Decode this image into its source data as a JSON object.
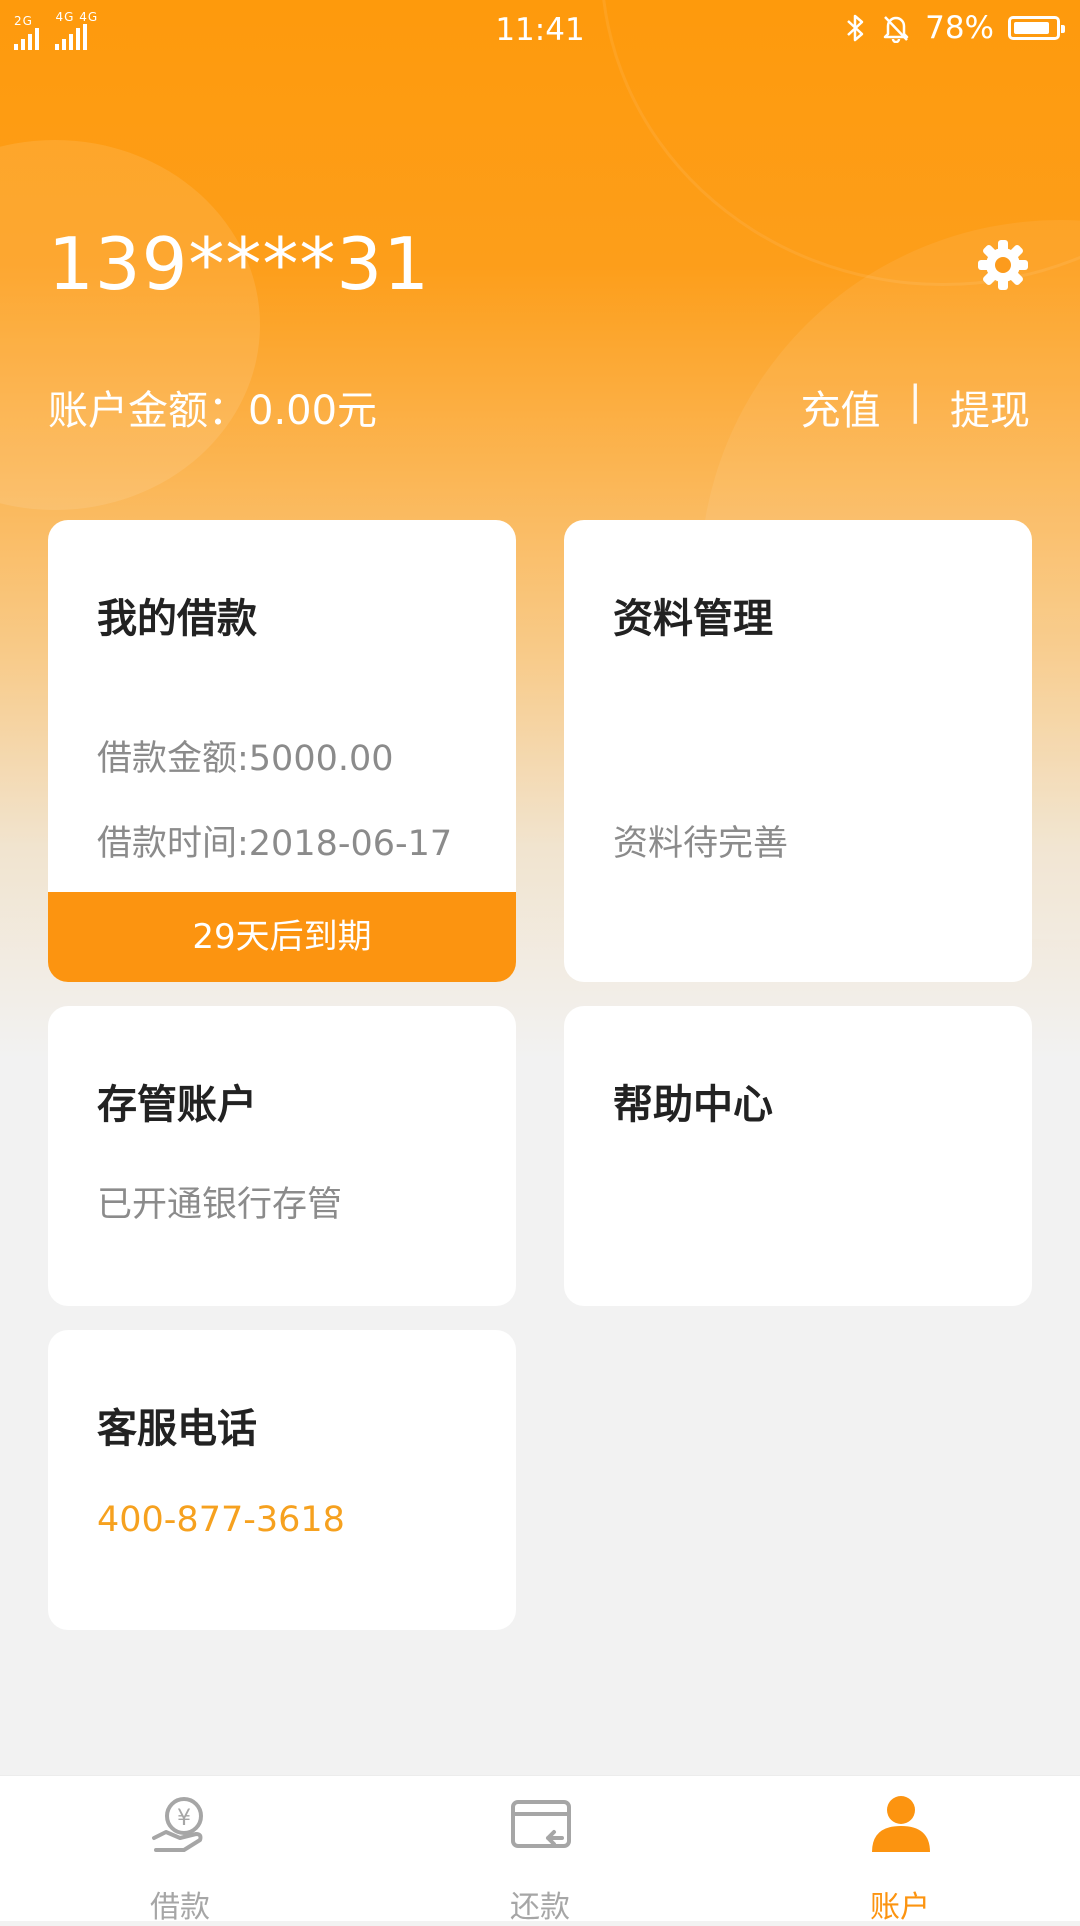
{
  "status_bar": {
    "network": "2G 4G 4G",
    "time": "11:41",
    "battery": "78%"
  },
  "account": {
    "phone": "139****31",
    "balance": "账户金额：0.00元",
    "recharge": "充值",
    "separator": "|",
    "withdraw": "提现"
  },
  "cards": {
    "loan": {
      "title": "我的借款",
      "amount": "借款金额:5000.00",
      "time": "借款时间:2018-06-17",
      "due": "29天后到期"
    },
    "profile": {
      "title": "资料管理",
      "status": "资料待完善"
    },
    "custody": {
      "title": "存管账户",
      "status": "已开通银行存管"
    },
    "help": {
      "title": "帮助中心"
    },
    "service": {
      "title": "客服电话",
      "phone": "400-877-3618"
    }
  },
  "tabbar": {
    "items": [
      {
        "label": "借款",
        "icon": "loan-icon",
        "active": false
      },
      {
        "label": "还款",
        "icon": "repay-icon",
        "active": false
      },
      {
        "label": "账户",
        "icon": "account-icon",
        "active": true
      }
    ]
  },
  "colors": {
    "accent": "#fc9410",
    "inactive": "#a6a6a6",
    "text_dark": "#222222",
    "text_gray": "#8b8b8b"
  }
}
